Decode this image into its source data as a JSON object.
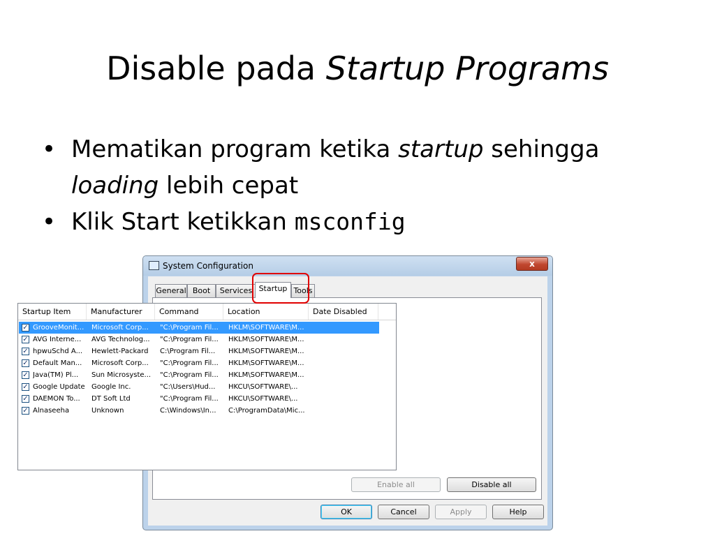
{
  "slide": {
    "title_plain": "Disable pada ",
    "title_italic": "Startup Programs",
    "bullet1_a": "Mematikan program ketika ",
    "bullet1_b": "startup",
    "bullet1_c": " sehingga",
    "bullet1_d": "loading",
    "bullet1_e": " lebih cepat",
    "bullet2_a": "Klik Start ketikkan ",
    "bullet2_b": "msconfig",
    "bullet_char": "•"
  },
  "dialog": {
    "title": "System Configuration",
    "close_label": "x",
    "tabs": [
      "General",
      "Boot",
      "Services",
      "Startup",
      "Tools"
    ],
    "active_tab": "Startup",
    "columns": [
      "Startup Item",
      "Manufacturer",
      "Command",
      "Location",
      "Date Disabled"
    ],
    "rows": [
      {
        "item": "GrooveMonit...",
        "manufacturer": "Microsoft Corp...",
        "command": "\"C:\\Program Fil...",
        "location": "HKLM\\SOFTWARE\\M...",
        "date": "",
        "checked": true,
        "selected": true
      },
      {
        "item": "AVG Interne...",
        "manufacturer": "AVG Technolog...",
        "command": "\"C:\\Program Fil...",
        "location": "HKLM\\SOFTWARE\\M...",
        "date": "",
        "checked": true,
        "selected": false
      },
      {
        "item": "hpwuSchd A...",
        "manufacturer": "Hewlett-Packard",
        "command": "C:\\Program Fil...",
        "location": "HKLM\\SOFTWARE\\M...",
        "date": "",
        "checked": true,
        "selected": false
      },
      {
        "item": "Default Man...",
        "manufacturer": "Microsoft Corp...",
        "command": "\"C:\\Program Fil...",
        "location": "HKLM\\SOFTWARE\\M...",
        "date": "",
        "checked": true,
        "selected": false
      },
      {
        "item": "Java(TM) Pl...",
        "manufacturer": "Sun Microsyste...",
        "command": "\"C:\\Program Fil...",
        "location": "HKLM\\SOFTWARE\\M...",
        "date": "",
        "checked": true,
        "selected": false
      },
      {
        "item": "Google Update",
        "manufacturer": "Google Inc.",
        "command": "\"C:\\Users\\Hud...",
        "location": "HKCU\\SOFTWARE\\...",
        "date": "",
        "checked": true,
        "selected": false
      },
      {
        "item": "DAEMON To...",
        "manufacturer": "DT Soft Ltd",
        "command": "\"C:\\Program Fil...",
        "location": "HKCU\\SOFTWARE\\...",
        "date": "",
        "checked": true,
        "selected": false
      },
      {
        "item": "Alnaseeha",
        "manufacturer": "Unknown",
        "command": "C:\\Windows\\In...",
        "location": "C:\\ProgramData\\Mic...",
        "date": "",
        "checked": true,
        "selected": false
      }
    ],
    "enable_all": "Enable all",
    "disable_all": "Disable all",
    "ok": "OK",
    "cancel": "Cancel",
    "apply": "Apply",
    "help": "Help",
    "selection_color": "#3399ff",
    "highlight_color": "#e00000"
  }
}
